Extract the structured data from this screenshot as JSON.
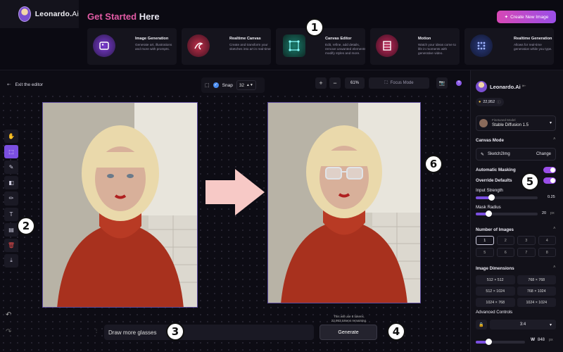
{
  "brand": {
    "name": "Leonardo.",
    "name_suffix": "Ai"
  },
  "header": {
    "title_a": "Get Started",
    "title_b": "Here",
    "create_btn": "Create New Image"
  },
  "cards": [
    {
      "title": "Image Generation",
      "desc": "Generate art, illustrations and more with prompts."
    },
    {
      "title": "Realtime Canvas",
      "desc": "Create and transform your sketches into art in real-time."
    },
    {
      "title": "Canvas Editor",
      "desc": "Edit, refine, add details, remove unwanted elements, modify styles and more."
    },
    {
      "title": "Motion",
      "desc": "Watch your ideas come to life in moments with generative video."
    },
    {
      "title": "Realtime Generation",
      "desc": "Allows for real-time generation while you type."
    }
  ],
  "toolbar": {
    "exit": "Exit the editor",
    "snap": "Snap",
    "snap_value": "32",
    "zoom": "61%",
    "focus": "Focus Mode",
    "zoom_in": "+",
    "zoom_out": "−"
  },
  "prompt": {
    "value": "Draw more glasses",
    "generate": "Generate",
    "tokens_line1": "This will use 8 tokens.",
    "tokens_line2": "22,953 tokens remaining."
  },
  "badges": [
    "1",
    "2",
    "3",
    "4",
    "5",
    "6"
  ],
  "panel": {
    "brand": "Leonardo.",
    "brand_suffix": "Ai",
    "tokens": "22,952",
    "model_label": "Finetuned Model",
    "model_name": "Stable Diffusion 1.5",
    "canvas_mode": "Canvas Mode",
    "sketch": "Sketch2Img",
    "change": "Change",
    "auto_mask": "Automatic Masking",
    "override": "Override Defaults",
    "input_strength": "Input Strength",
    "input_strength_val": "0.25",
    "mask_radius": "Mask Radius",
    "mask_radius_val": "20",
    "mask_radius_unit": "px",
    "num_images": "Number of Images",
    "nums": [
      "1",
      "2",
      "3",
      "4",
      "5",
      "6",
      "7",
      "8"
    ],
    "image_dims": "Image Dimensions",
    "dims": [
      "512 × 512",
      "768 × 768",
      "512 × 1024",
      "768 × 1024",
      "1024 × 768",
      "1024 × 1024"
    ],
    "advanced": "Advanced Controls",
    "ratio": "3:4",
    "width_label": "W",
    "width_val": "848",
    "width_unit": "px"
  },
  "state": {
    "input_strength": 0.25,
    "mask_radius_fraction": 0.2,
    "width_fraction": 0.25,
    "selected_num_images": 1
  },
  "colors": {
    "accent": "#9a4ee8",
    "pink": "#e25ba5",
    "bg": "#0d0c14"
  }
}
